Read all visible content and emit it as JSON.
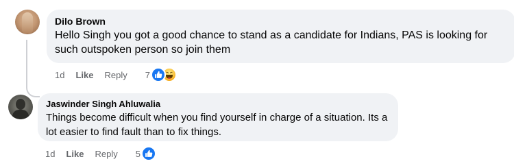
{
  "comments": [
    {
      "author": "Dilo Brown",
      "text": "Hello Singh you got a good chance to stand as a candidate for Indians, PAS is looking for such outspoken person so join them",
      "time": "1d",
      "like_label": "Like",
      "reply_label": "Reply",
      "reaction_count": "7",
      "reactions": [
        "like-icon",
        "haha-icon"
      ]
    },
    {
      "author": "Jaswinder Singh Ahluwalia",
      "text": "Things become difficult when you find yourself in charge of a situation. Its a lot easier to find fault than to fix things.",
      "time": "1d",
      "like_label": "Like",
      "reply_label": "Reply",
      "reaction_count": "5",
      "reactions": [
        "like-icon"
      ]
    }
  ],
  "colors": {
    "bubble": "#f0f2f5",
    "secondary_text": "#65676b",
    "like_blue": "#1877f2",
    "haha_yellow": "#f7b125"
  }
}
